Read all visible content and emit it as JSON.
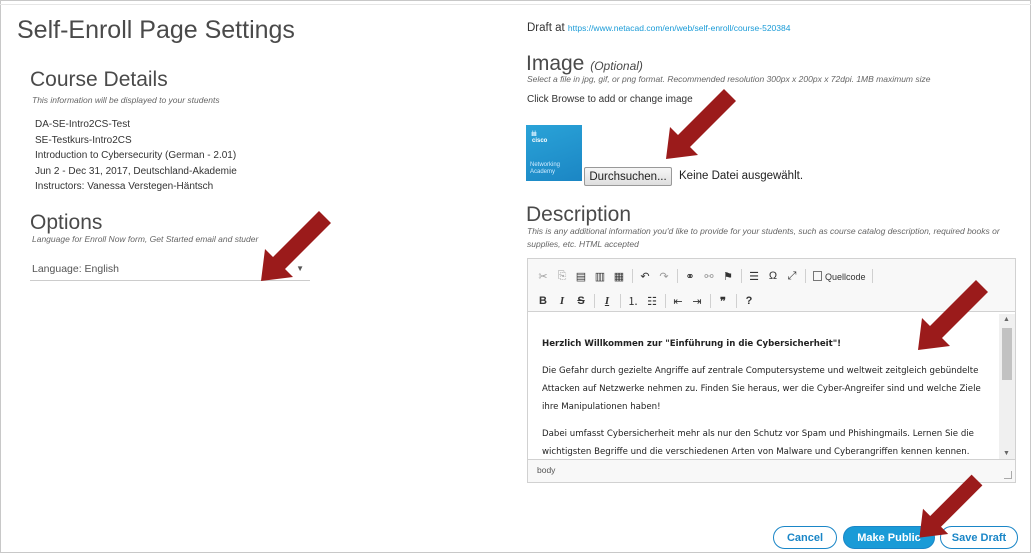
{
  "page": {
    "title": "Self-Enroll Page Settings"
  },
  "course_details": {
    "heading": "Course Details",
    "subtitle": "This information will be displayed to your students",
    "lines": [
      "DA-SE-Intro2CS-Test",
      "SE-Testkurs-Intro2CS",
      "Introduction to Cybersecurity (German - 2.01)",
      "Jun 2 - Dec 31, 2017, Deutschland-Akademie",
      "Instructors: Vanessa Verstegen-Häntsch"
    ]
  },
  "options": {
    "heading": "Options",
    "subtitle": "Language for Enroll Now form, Get Started email and studer",
    "language_value": "Language: English"
  },
  "draft": {
    "label": "Draft at",
    "url": "https://www.netacad.com/en/web/self-enroll/course-520384"
  },
  "image_section": {
    "heading": "Image",
    "optional": "(Optional)",
    "subtitle": "Select a file in jpg, gif, or png format. Recommended resolution 300px x 200px x 72dpi. 1MB maximum size",
    "instruction": "Click Browse to add or change image",
    "thumb_brand": "cisco",
    "thumb_line1": "Networking",
    "thumb_line2": "Academy",
    "browse_label": "Durchsuchen...",
    "no_file": "Keine Datei ausgewählt."
  },
  "description": {
    "heading": "Description",
    "subtitle": "This is any additional information you'd like to provide for your students, such as course catalog description, required books or supplies, etc. HTML accepted",
    "toolbar_source_label": "Quellcode",
    "content": {
      "intro": "Herzlich Willkommen zur \"Einführung in die Cybersicherheit\"!",
      "p1": "Die Gefahr durch gezielte Angriffe auf zentrale Computersysteme und weltweit zeitgleich gebündelte Attacken auf Netzwerke nehmen zu. Finden Sie heraus, wer die Cyber-Angreifer sind und welche Ziele ihre Manipulationen haben!",
      "p2": "Dabei umfasst Cybersicherheit mehr als nur den Schutz vor Spam und Phishingmails. Lernen Sie die wichtigsten Begriffe und die verschiedenen Arten von Malware und Cyberangriffen kennen kennen. Erfahren Sie, wie sich Unternehmen vor diesen Angriffen schützen. Werden Sie sich der Bedeutung des"
    },
    "status_path": "body"
  },
  "buttons": {
    "cancel": "Cancel",
    "make_public": "Make Public",
    "save_draft": "Save Draft"
  },
  "colors": {
    "accent": "#1a9bd7",
    "annotation_arrow": "#9b1b1b"
  },
  "icons": {
    "toolbar_row1": [
      "cut-icon",
      "copy-icon",
      "paste-icon",
      "paste-text-icon",
      "paste-word-icon",
      "undo-icon",
      "redo-icon",
      "link-icon",
      "unlink-icon",
      "anchor-icon",
      "horizontal-rule-icon",
      "special-char-icon",
      "maximize-icon",
      "source-icon"
    ],
    "toolbar_row2": [
      "bold-icon",
      "italic-icon",
      "strike-icon",
      "remove-format-icon",
      "numbered-list-icon",
      "bulleted-list-icon",
      "outdent-icon",
      "indent-icon",
      "blockquote-icon",
      "help-icon"
    ]
  }
}
